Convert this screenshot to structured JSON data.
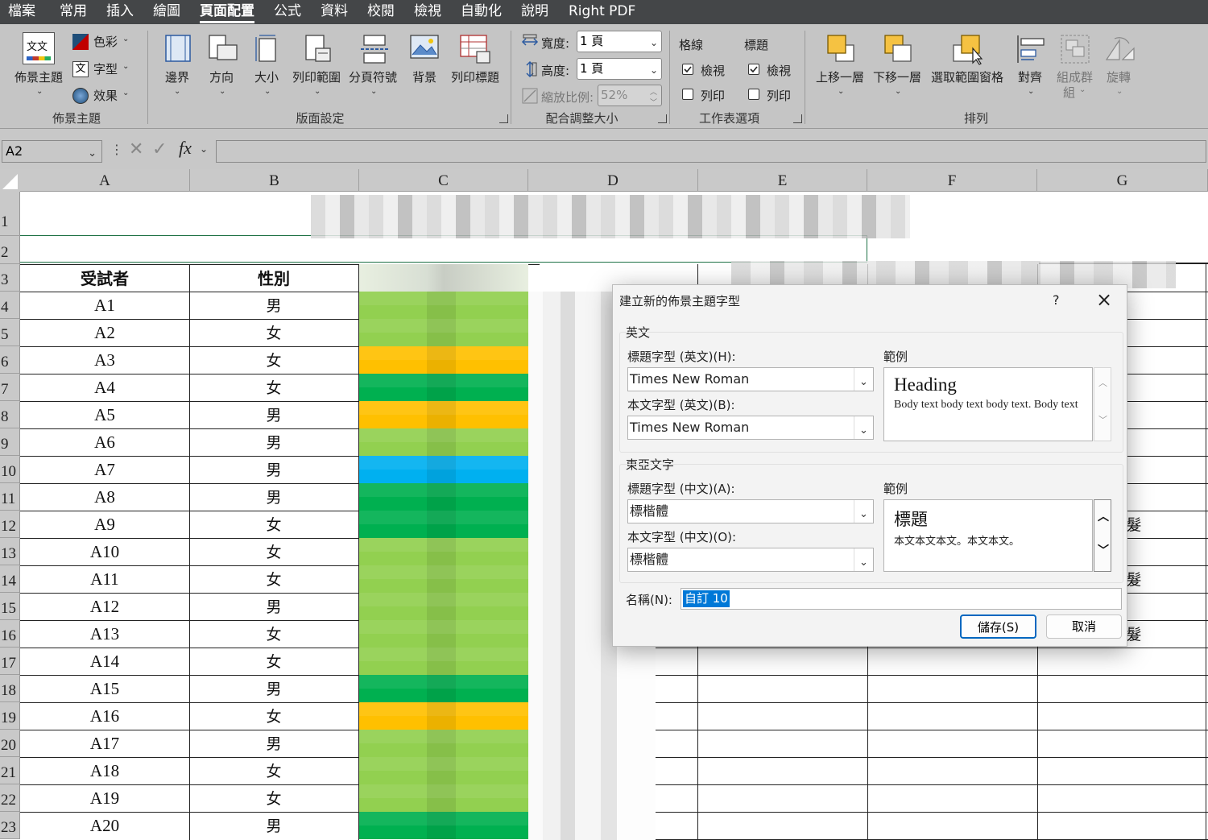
{
  "menu_tabs": [
    "檔案",
    "常用",
    "插入",
    "繪圖",
    "頁面配置",
    "公式",
    "資料",
    "校閱",
    "檢視",
    "自動化",
    "說明",
    "Right PDF"
  ],
  "active_tab": "頁面配置",
  "ribbon": {
    "theme_group": {
      "themes_label": "佈景主題",
      "colors_label": "色彩",
      "fonts_label": "字型",
      "effects_label": "效果",
      "group_label": "佈景主題"
    },
    "page_setup_group": {
      "margins": "邊界",
      "orientation": "方向",
      "size": "大小",
      "print_area": "列印範圍",
      "breaks": "分頁符號",
      "background": "背景",
      "print_titles": "列印標題",
      "group_label": "版面設定"
    },
    "scale_group": {
      "width_label": "寬度:",
      "width_value": "1 頁",
      "height_label": "高度:",
      "height_value": "1 頁",
      "scale_label": "縮放比例:",
      "scale_value": "52%",
      "group_label": "配合調整大小"
    },
    "sheet_options_group": {
      "gridlines": "格線",
      "headings": "標題",
      "view": "檢視",
      "print": "列印",
      "group_label": "工作表選項"
    },
    "arrange_group": {
      "bring_forward": "上移一層",
      "send_backward": "下移一層",
      "selection_pane": "選取範圍窗格",
      "align": "對齊",
      "group_line1": "組成群",
      "group_line2": "組",
      "rotate": "旋轉",
      "group_label": "排列"
    }
  },
  "formula_bar": {
    "name_box": "A2",
    "fx": "fx"
  },
  "columns": [
    "A",
    "B",
    "C",
    "D",
    "E",
    "F",
    "G"
  ],
  "rows": [
    "1",
    "2",
    "3",
    "4",
    "5",
    "6",
    "7",
    "8",
    "9",
    "10",
    "11",
    "12",
    "13",
    "14",
    "15",
    "16",
    "17",
    "18",
    "19",
    "20",
    "21",
    "22",
    "23"
  ],
  "table_headers": {
    "subject": "受試者",
    "gender": "性別"
  },
  "subjects": [
    {
      "id": "A1",
      "gender": "男"
    },
    {
      "id": "A2",
      "gender": "女"
    },
    {
      "id": "A3",
      "gender": "女"
    },
    {
      "id": "A4",
      "gender": "女"
    },
    {
      "id": "A5",
      "gender": "男"
    },
    {
      "id": "A6",
      "gender": "男"
    },
    {
      "id": "A7",
      "gender": "男"
    },
    {
      "id": "A8",
      "gender": "男"
    },
    {
      "id": "A9",
      "gender": "女"
    },
    {
      "id": "A10",
      "gender": "女"
    },
    {
      "id": "A11",
      "gender": "女"
    },
    {
      "id": "A12",
      "gender": "男"
    },
    {
      "id": "A13",
      "gender": "女"
    },
    {
      "id": "A14",
      "gender": "女"
    },
    {
      "id": "A15",
      "gender": "男"
    },
    {
      "id": "A16",
      "gender": "女"
    },
    {
      "id": "A17",
      "gender": "男"
    },
    {
      "id": "A18",
      "gender": "女"
    },
    {
      "id": "A19",
      "gender": "女"
    },
    {
      "id": "A20",
      "gender": "男"
    }
  ],
  "heat_colors": [
    "#92d050",
    "#92d050",
    "#ffc000",
    "#00b050",
    "#ffc000",
    "#92d050",
    "#00b0f0",
    "#00b050",
    "#00b050",
    "#92d050",
    "#92d050",
    "#92d050",
    "#92d050",
    "#92d050",
    "#00b050",
    "#ffc000",
    "#92d050",
    "#92d050",
    "#92d050",
    "#00b050"
  ],
  "edge_glyph": "髮",
  "dialog": {
    "title": "建立新的佈景主題字型",
    "help": "?",
    "close": "×",
    "latin_section": "英文",
    "heading_font_latin_label": "標題字型 (英文)(H):",
    "heading_font_latin": "Times New Roman",
    "body_font_latin_label": "本文字型 (英文)(B):",
    "body_font_latin": "Times New Roman",
    "sample_label": "範例",
    "sample_heading_latin": "Heading",
    "sample_body_latin": "Body text body text body text. Body text",
    "ea_section": "東亞文字",
    "heading_font_ea_label": "標題字型 (中文)(A):",
    "heading_font_ea": "標楷體",
    "body_font_ea_label": "本文字型 (中文)(O):",
    "body_font_ea": "標楷體",
    "sample_heading_ea": "標題",
    "sample_body_ea": "本文本文本文。本文本文。",
    "name_label": "名稱(N):",
    "name_value": "自訂 10",
    "save": "儲存(S)",
    "cancel": "取消"
  }
}
